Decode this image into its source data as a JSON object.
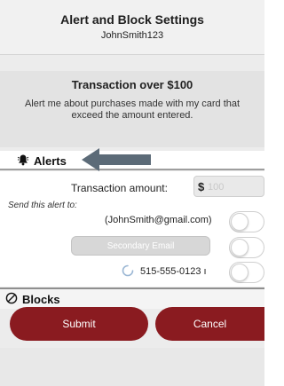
{
  "header": {
    "title": "Alert and Block Settings",
    "username": "JohnSmith123"
  },
  "transaction": {
    "title": "Transaction over $100",
    "description": "Alert me about purchases made with my card that exceed the amount entered."
  },
  "alerts": {
    "label": "Alerts",
    "icon": "bell-icon",
    "amount_label": "Transaction amount:",
    "currency": "$",
    "amount_placeholder": "100",
    "send_to_label": "Send this alert to:",
    "recipients": {
      "email": "(JohnSmith@gmail.com)",
      "secondary_email_placeholder": "Secondary Email",
      "phone": "515-555-0123 ı"
    },
    "toggles": {
      "email": false,
      "secondary_email": false,
      "phone": false
    }
  },
  "blocks": {
    "label": "Blocks",
    "icon": "block-icon"
  },
  "actions": {
    "submit_label": "Submit",
    "cancel_label": "Cancel"
  },
  "colors": {
    "accent": "#8a1b20",
    "arrow": "#5c6b78",
    "background": "#ececec"
  }
}
